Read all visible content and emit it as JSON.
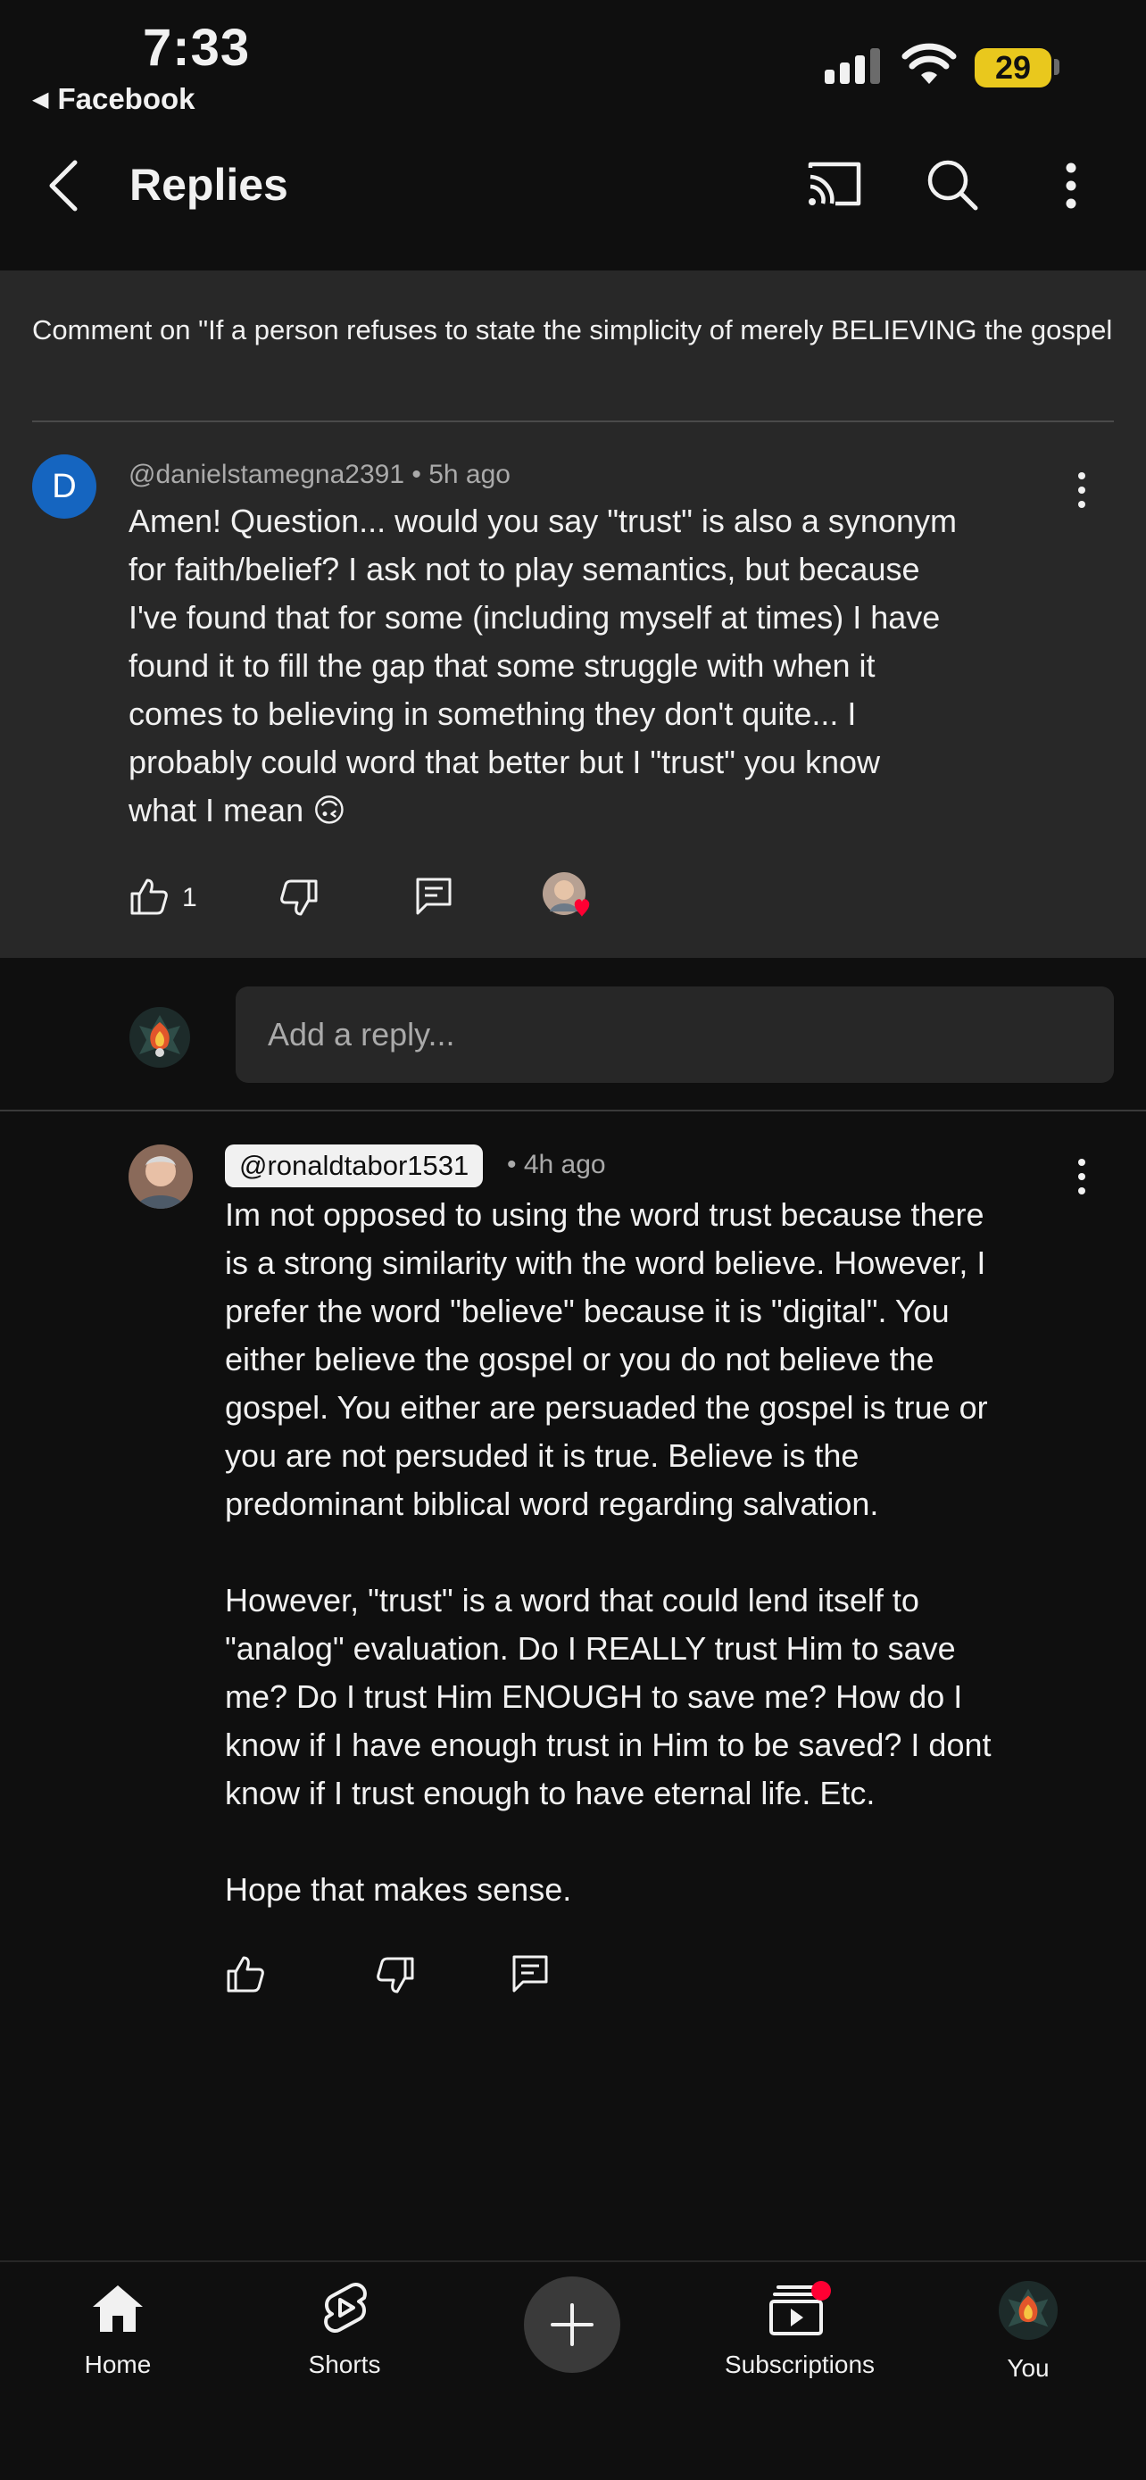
{
  "status_bar": {
    "time": "7:33",
    "back_app": "Facebook",
    "battery": "29"
  },
  "header": {
    "title": "Replies"
  },
  "context": {
    "text": "Comment on \"If a person refuses to state the simplicity of merely BELIEVING the gospel message for salvation, be alarmed and avoid that messenger. He is a fa..."
  },
  "parent_comment": {
    "avatar_letter": "D",
    "author": "@danielstamegna2391",
    "time": "5h ago",
    "lines": [
      "Amen! Question... would you say \"trust\" is also a synonym",
      "for faith/belief? I ask not to play semantics, but because",
      "I've found that for some (including myself at times) I have",
      "found it to fill the gap that some struggle with when it",
      "comes to believing in something they don't quite... I",
      "probably could word that better but I \"trust\" you know",
      "what I mean"
    ],
    "emoji": "🙃",
    "like_count": "1"
  },
  "reply_input": {
    "placeholder": "Add a reply..."
  },
  "reply": {
    "author": "@ronaldtabor1531",
    "time": "4h ago",
    "paragraph1": [
      "Im not opposed to using the word trust because there",
      "is a strong similarity with the word believe. However, I",
      "prefer the word \"believe\" because it is \"digital\". You",
      "either believe the gospel or you do not believe the",
      "gospel. You either are persuaded the gospel is true or",
      "you are not persuded it is true. Believe is the",
      "predominant biblical word regarding salvation."
    ],
    "paragraph2": [
      "However, \"trust\" is a word that could lend itself to",
      "\"analog\" evaluation. Do I REALLY trust Him to save",
      "me? Do I trust Him ENOUGH to save me? How do I",
      "know if I have enough trust in Him to be saved? I dont",
      "know if I trust enough to have eternal life. Etc."
    ],
    "paragraph3": "Hope that makes sense."
  },
  "bottom_nav": {
    "items": [
      {
        "label": "Home"
      },
      {
        "label": "Shorts"
      },
      {
        "label": "Subscriptions"
      },
      {
        "label": "You"
      }
    ]
  },
  "colors": {
    "background": "#0f0f0f",
    "parent_bg": "#282828",
    "accent_red": "#ff0033",
    "avatar_blue": "#1565c0",
    "battery_yellow": "#e9c81d"
  }
}
